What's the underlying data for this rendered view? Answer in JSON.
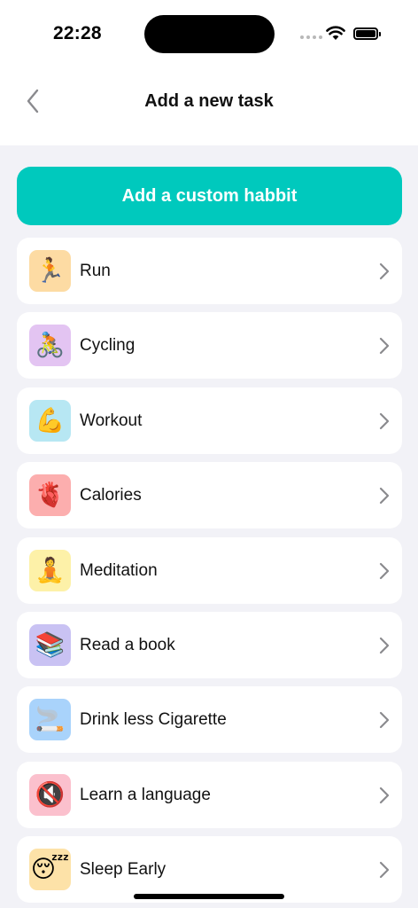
{
  "status_bar": {
    "time": "22:28"
  },
  "nav": {
    "title": "Add a new task"
  },
  "custom_button": {
    "label": "Add a custom habbit"
  },
  "tasks": [
    {
      "label": "Run",
      "emoji": "🏃",
      "tile_color": "#fddba3"
    },
    {
      "label": "Cycling",
      "emoji": "🚴",
      "tile_color": "#e3c4f2"
    },
    {
      "label": "Workout",
      "emoji": "💪",
      "tile_color": "#b7e7f3"
    },
    {
      "label": "Calories",
      "emoji": "🫀",
      "tile_color": "#fcaeae"
    },
    {
      "label": "Meditation",
      "emoji": "🧘",
      "tile_color": "#fdf1a8"
    },
    {
      "label": "Read a book",
      "emoji": "📚",
      "tile_color": "#c9c2f3"
    },
    {
      "label": "Drink less Cigarette",
      "emoji": "🚬",
      "tile_color": "#a9d3fb"
    },
    {
      "label": "Learn a language",
      "emoji": "🔇",
      "tile_color": "#fbc0cd"
    },
    {
      "label": "Sleep Early",
      "emoji": "😴",
      "tile_color": "#fde2a8"
    }
  ],
  "colors": {
    "accent": "#00c9bd",
    "background": "#f2f2f7"
  }
}
